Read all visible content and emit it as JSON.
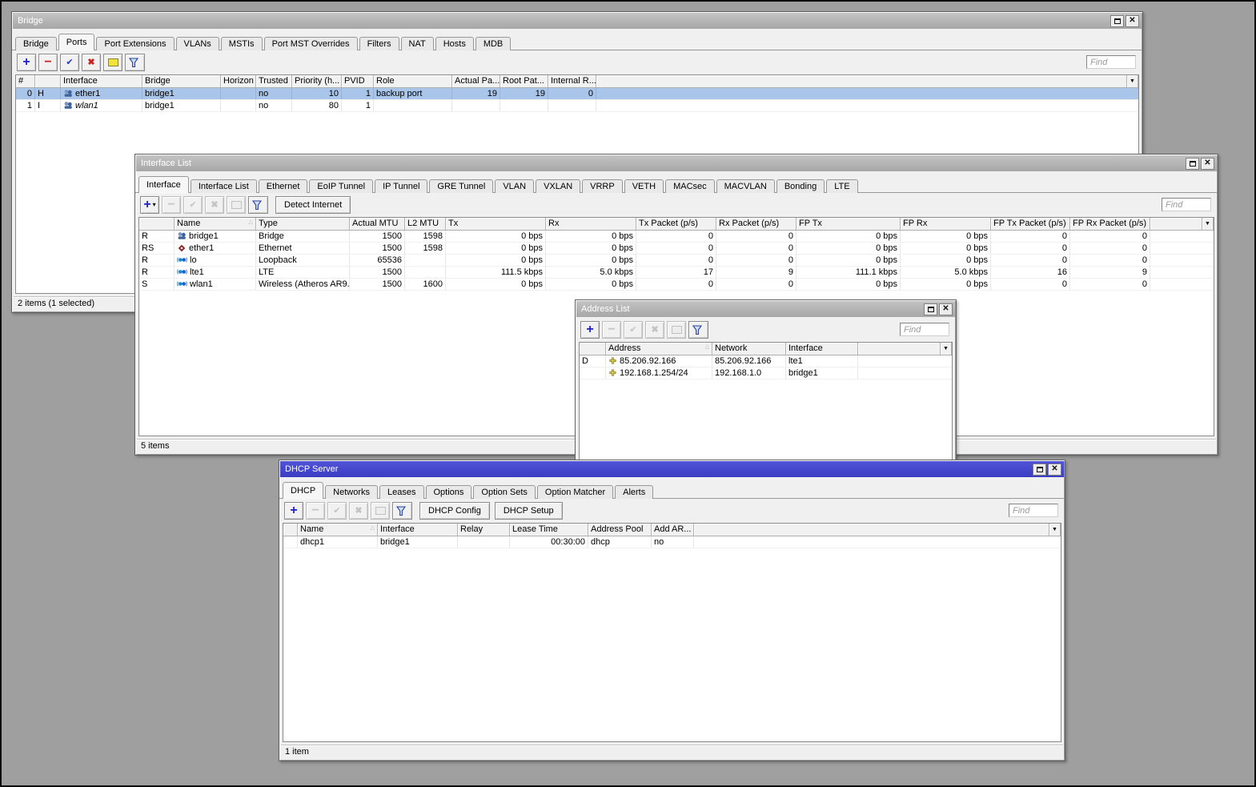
{
  "icons": {
    "add": "+",
    "remove": "−",
    "check": "✔",
    "cross": "✖",
    "close": "✕",
    "dropdown": "▼",
    "caret": "▾",
    "sort": "△"
  },
  "colors": {
    "desktop_bg": "#9f9f9f",
    "active_titlebar": "#4346cf",
    "inactive_titlebar": "#b2b2b2",
    "selection": "#a9c6ea"
  },
  "windows": {
    "bridge": {
      "title": "Bridge",
      "tabs": [
        "Bridge",
        "Ports",
        "Port Extensions",
        "VLANs",
        "MSTIs",
        "Port MST Overrides",
        "Filters",
        "NAT",
        "Hosts",
        "MDB"
      ],
      "active_tab": "Ports",
      "find_placeholder": "Find",
      "columns": [
        "#",
        "",
        "Interface",
        "Bridge",
        "Horizon",
        "Trusted",
        "Priority (h...",
        "PVID",
        "Role",
        "Actual Pa...",
        "Root Pat...",
        "Internal R..."
      ],
      "rows": [
        {
          "num": "0",
          "flags": "H",
          "interface": "ether1",
          "bridge": "bridge1",
          "horizon": "",
          "trusted": "no",
          "priority": "10",
          "pvid": "1",
          "role": "backup port",
          "actual_path_cost": "19",
          "root_path_cost": "19",
          "internal_root": "0"
        },
        {
          "num": "1",
          "flags": "I",
          "interface": "wlan1",
          "bridge": "bridge1",
          "horizon": "",
          "trusted": "no",
          "priority": "80",
          "pvid": "1",
          "role": "",
          "actual_path_cost": "",
          "root_path_cost": "",
          "internal_root": ""
        }
      ],
      "status": "2 items (1 selected)"
    },
    "interface_list": {
      "title": "Interface List",
      "tabs": [
        "Interface",
        "Interface List",
        "Ethernet",
        "EoIP Tunnel",
        "IP Tunnel",
        "GRE Tunnel",
        "VLAN",
        "VXLAN",
        "VRRP",
        "VETH",
        "MACsec",
        "MACVLAN",
        "Bonding",
        "LTE"
      ],
      "active_tab": "Interface",
      "detect_button": "Detect Internet",
      "find_placeholder": "Find",
      "columns": [
        "",
        "Name",
        "Type",
        "Actual MTU",
        "L2 MTU",
        "Tx",
        "Rx",
        "Tx Packet (p/s)",
        "Rx Packet (p/s)",
        "FP Tx",
        "FP Rx",
        "FP Tx Packet (p/s)",
        "FP Rx Packet (p/s)"
      ],
      "rows": [
        {
          "flags": "R",
          "name": "bridge1",
          "type": "Bridge",
          "actual_mtu": "1500",
          "l2_mtu": "1598",
          "tx": "0 bps",
          "rx": "0 bps",
          "tx_packet": "0",
          "rx_packet": "0",
          "fp_tx": "0 bps",
          "fp_rx": "0 bps",
          "fp_tx_packet": "0",
          "fp_rx_packet": "0"
        },
        {
          "flags": "RS",
          "name": "ether1",
          "type": "Ethernet",
          "actual_mtu": "1500",
          "l2_mtu": "1598",
          "tx": "0 bps",
          "rx": "0 bps",
          "tx_packet": "0",
          "rx_packet": "0",
          "fp_tx": "0 bps",
          "fp_rx": "0 bps",
          "fp_tx_packet": "0",
          "fp_rx_packet": "0"
        },
        {
          "flags": "R",
          "name": "lo",
          "type": "Loopback",
          "actual_mtu": "65536",
          "l2_mtu": "",
          "tx": "0 bps",
          "rx": "0 bps",
          "tx_packet": "0",
          "rx_packet": "0",
          "fp_tx": "0 bps",
          "fp_rx": "0 bps",
          "fp_tx_packet": "0",
          "fp_rx_packet": "0"
        },
        {
          "flags": "R",
          "name": "lte1",
          "type": "LTE",
          "actual_mtu": "1500",
          "l2_mtu": "",
          "tx": "111.5 kbps",
          "rx": "5.0 kbps",
          "tx_packet": "17",
          "rx_packet": "9",
          "fp_tx": "111.1 kbps",
          "fp_rx": "5.0 kbps",
          "fp_tx_packet": "16",
          "fp_rx_packet": "9"
        },
        {
          "flags": "S",
          "name": "wlan1",
          "type": "Wireless (Atheros AR9...",
          "actual_mtu": "1500",
          "l2_mtu": "1600",
          "tx": "0 bps",
          "rx": "0 bps",
          "tx_packet": "0",
          "rx_packet": "0",
          "fp_tx": "0 bps",
          "fp_rx": "0 bps",
          "fp_tx_packet": "0",
          "fp_rx_packet": "0"
        }
      ],
      "status": "5 items"
    },
    "address_list": {
      "title": "Address List",
      "find_placeholder": "Find",
      "columns": [
        "",
        "Address",
        "Network",
        "Interface"
      ],
      "rows": [
        {
          "flags": "D",
          "address": "85.206.92.166",
          "network": "85.206.92.166",
          "interface": "lte1"
        },
        {
          "flags": "",
          "address": "192.168.1.254/24",
          "network": "192.168.1.0",
          "interface": "bridge1"
        }
      ]
    },
    "dhcp_server": {
      "title": "DHCP Server",
      "tabs": [
        "DHCP",
        "Networks",
        "Leases",
        "Options",
        "Option Sets",
        "Option Matcher",
        "Alerts"
      ],
      "active_tab": "DHCP",
      "config_button": "DHCP Config",
      "setup_button": "DHCP Setup",
      "find_placeholder": "Find",
      "columns": [
        "",
        "Name",
        "Interface",
        "Relay",
        "Lease Time",
        "Address Pool",
        "Add AR..."
      ],
      "rows": [
        {
          "flags": "",
          "name": "dhcp1",
          "interface": "bridge1",
          "relay": "",
          "lease_time": "00:30:00",
          "address_pool": "dhcp",
          "add_arp": "no"
        }
      ],
      "status": "1 item"
    }
  }
}
